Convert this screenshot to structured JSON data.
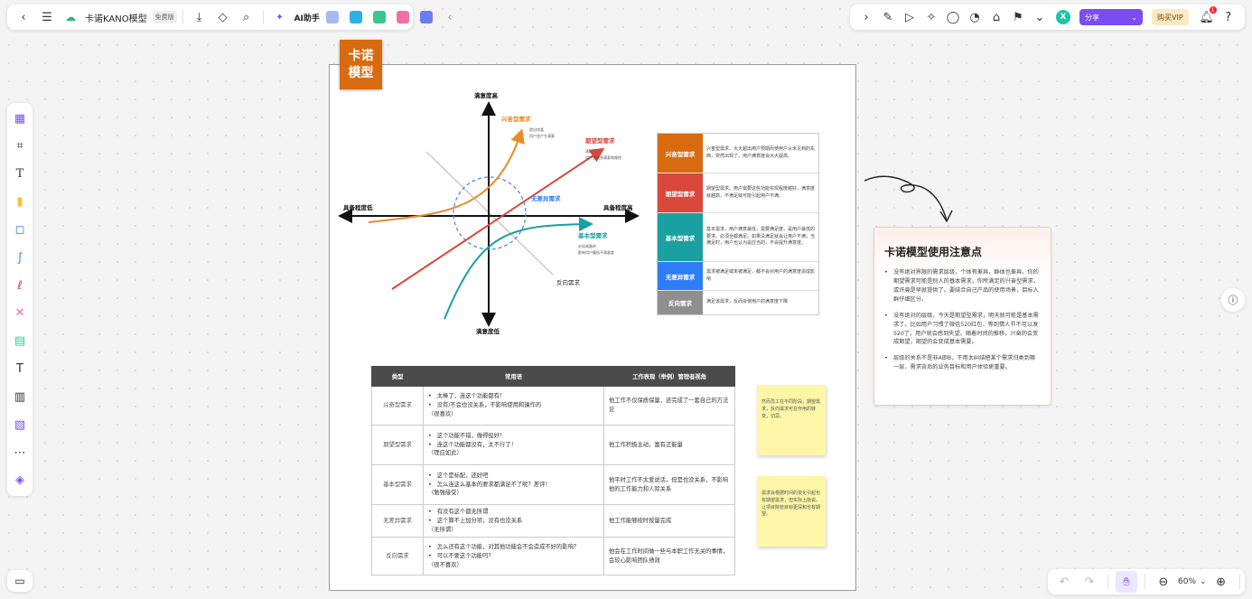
{
  "toolbar": {
    "title": "卡诺KANO模型",
    "badge": "免费版",
    "ai_label": "AI助手"
  },
  "topright": {
    "avatar": "X",
    "share_label": "分享",
    "vip_label": "购买VIP",
    "notif_count": "1"
  },
  "zoom": "60%",
  "canvas": {
    "title_line1": "卡诺",
    "title_line2": "模型",
    "diagram": {
      "y_top": "满意度高",
      "y_bottom": "满意度低",
      "x_left": "具备程度低",
      "x_right": "具备程度高",
      "excitement": "兴奋型需求",
      "excitement_note1": "提出惊喜",
      "excitement_note2": "用户会产生满意",
      "performance": "期望型需求",
      "performance_note1": "满足了",
      "performance_note2": "用户会感到满意和愉悦",
      "indifferent": "无差异需求",
      "basic": "基本型需求",
      "basic_note1": "必须具备的",
      "basic_note2": "影响用户最低不满意度",
      "reverse": "反向需求"
    },
    "legend": [
      {
        "key": "兴奋型需求",
        "color": "#d86a10",
        "desc": "兴奋型需求。大大超出用户预期而使用户从未见到的东西，突然出现了，用户满意度会大大提高。"
      },
      {
        "key": "期望型需求",
        "color": "#d9483b",
        "desc": "期望型需求。用户需要这些功能实现程度越好，满意度就越高，不满足就可能引起用户不满。"
      },
      {
        "key": "基本型需求",
        "color": "#1aa0a0",
        "desc": "基本需求，用户满意最低，需要满足度，是用户最低的要求。必须全都满足。如果没满足就会让用户不满；当满足时，用户也认为是应当的，不会提升满意度。"
      },
      {
        "key": "无差异需求",
        "color": "#2f7df6",
        "desc": "需求被满足或未被满足，都不会对用户的满意度造成影响"
      },
      {
        "key": "反向需求",
        "color": "#8f8f8f",
        "desc": "满足该需求，反而会使用户的满意度下降"
      }
    ],
    "table": {
      "headers": [
        "类型",
        "常用语",
        "工作表现（举例）管理者视角"
      ],
      "rows": [
        {
          "type": "兴奋型需求",
          "phrases": [
            "太棒了，连这个功能都有！",
            "没有/不会也没关系，不影响使用和操作的"
          ],
          "tail": "（很喜欢）",
          "perf": "他工作不仅保质保量，还完成了一套自己的方法论"
        },
        {
          "type": "期望型需求",
          "phrases": [
            "这个功能不错，做得挺好！",
            "连这个功能都没有，太不行了！"
          ],
          "tail": "（理应如此）",
          "perf": "他工作积极主动，富有正能量"
        },
        {
          "type": "基本型需求",
          "phrases": [
            "这个是标配，还好吧",
            "怎么连这么基本的要求都满足不了呢？差评！"
          ],
          "tail": "（勉强接受）",
          "perf": "他平时工作不太爱说话，但是也没关系，不影响他的工作能力和人际关系"
        },
        {
          "type": "无差异需求",
          "phrases": [
            "有没有这个都无所谓",
            "这个算不上加分项，没有也没关系"
          ],
          "tail": "（无所谓）",
          "perf": "他工作能够按时按量完成"
        },
        {
          "type": "反向需求",
          "phrases": [
            "怎么还有这个功能，对其他功能会不会造成不好的影响？",
            "可以不要这个功能吗？"
          ],
          "tail": "（很不喜欢）",
          "perf": "他会在工作时间做一些与本职工作无关的事情，会较心影响团队绩效"
        }
      ]
    },
    "sticky1": "然而员工在不同阶段，期望需求，反向需求可在作用的转变，切忌。",
    "sticky2": "需求会根据时间的变化引起也有期望需求，但实际上能说，让项目除管目标更深和也有期望。",
    "notes": {
      "title": "卡诺模型使用注意点",
      "items": [
        "没有绝对界限的需求层级，个体有差异，群体也差异。你的期望需求可能是别人的基本需求，你所满足的兴奋型需求，或许竟是早就提供了。要结合自己产品的使用场景，目标人群仔细区分。",
        "没有绝对的层级，今天是期望型需求，明天就可能是基本需求了。比如用户习惯了微信520红包，等到情人节不可以发520了，用户就会感到失望。随着时间的推移，兴奋的会变成期望，期望的会变成基本需要。",
        "层级的关系不是非A即B，不用太纠结把某个需求归类到哪一层，需求背后的业务目标和用户体验更重要。"
      ]
    }
  }
}
